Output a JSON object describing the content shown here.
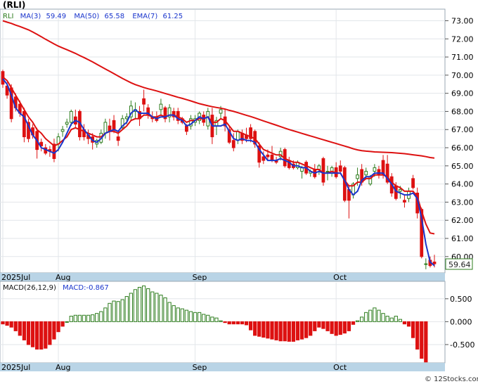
{
  "title": "(RLI)",
  "footer": "© 12Stocks.com",
  "last_price_tag": "59.64",
  "legend": {
    "ticker": "RLI",
    "ma3": "MA(3)",
    "ma3_val": "59.49",
    "ma50": "MA(50)",
    "ma50_val": "65.58",
    "ema7": "EMA(7)",
    "ema7_val": "61.25"
  },
  "macd_legend": {
    "name": "MACD(26,12,9)",
    "macd": "MACD:-0.867"
  },
  "colors": {
    "up": "#2e7d1e",
    "down": "#dd1111",
    "ma3": "#1a35cc",
    "ma50": "#dd1111",
    "ema7": "#dd1111",
    "axis_band": "#b9d4e6"
  },
  "chart_data": [
    {
      "type": "candlestick",
      "title": "(RLI)",
      "ylim": [
        59.1,
        73.6
      ],
      "yticks": [
        "73.00",
        "72.00",
        "71.00",
        "70.00",
        "69.00",
        "68.00",
        "67.00",
        "66.00",
        "65.00",
        "64.00",
        "63.00",
        "62.00",
        "61.00",
        "60.00"
      ],
      "xticks": [
        {
          "label": "2025Jul",
          "index": 0
        },
        {
          "label": "Aug",
          "index": 13
        },
        {
          "label": "Sep",
          "index": 45
        },
        {
          "label": "Oct",
          "index": 78
        }
      ],
      "ohlc": [
        [
          70.2,
          70.3,
          69.3,
          69.5
        ],
        [
          69.4,
          69.6,
          68.7,
          68.9
        ],
        [
          69.3,
          69.5,
          67.4,
          67.6
        ],
        [
          68.8,
          69.0,
          68.0,
          68.2
        ],
        [
          68.4,
          68.6,
          67.7,
          67.9
        ],
        [
          68.0,
          68.2,
          66.3,
          66.6
        ],
        [
          67.4,
          67.6,
          66.3,
          66.5
        ],
        [
          67.1,
          67.3,
          66.5,
          66.7
        ],
        [
          66.9,
          67.1,
          65.4,
          65.9
        ],
        [
          66.3,
          66.5,
          65.8,
          66.1
        ],
        [
          66.0,
          66.2,
          65.6,
          65.7
        ],
        [
          65.9,
          66.1,
          65.5,
          65.8
        ],
        [
          66.2,
          66.5,
          65.2,
          65.4
        ],
        [
          66.2,
          66.8,
          65.8,
          66.6
        ],
        [
          66.9,
          67.2,
          66.6,
          67.0
        ],
        [
          67.3,
          67.6,
          67.1,
          67.4
        ],
        [
          67.4,
          68.1,
          67.2,
          68.0
        ],
        [
          67.7,
          68.1,
          67.1,
          67.3
        ],
        [
          68.0,
          68.1,
          66.4,
          66.6
        ],
        [
          67.0,
          67.3,
          66.4,
          66.6
        ],
        [
          66.7,
          67.0,
          66.2,
          66.5
        ],
        [
          66.6,
          66.8,
          65.9,
          66.3
        ],
        [
          66.2,
          66.5,
          66.0,
          66.4
        ],
        [
          66.3,
          67.0,
          66.2,
          66.8
        ],
        [
          66.8,
          67.6,
          66.5,
          67.4
        ],
        [
          67.2,
          67.6,
          66.4,
          66.9
        ],
        [
          67.5,
          67.8,
          66.8,
          67.0
        ],
        [
          66.6,
          66.9,
          66.1,
          66.4
        ],
        [
          67.1,
          67.8,
          67.0,
          67.6
        ],
        [
          67.6,
          67.9,
          67.3,
          67.7
        ],
        [
          67.7,
          68.6,
          67.5,
          68.3
        ],
        [
          68.0,
          68.5,
          67.6,
          68.1
        ],
        [
          68.0,
          68.3,
          67.2,
          67.6
        ],
        [
          68.7,
          69.2,
          68.0,
          68.4
        ],
        [
          68.2,
          68.4,
          67.6,
          67.8
        ],
        [
          67.7,
          68.0,
          67.4,
          67.6
        ],
        [
          67.7,
          68.0,
          67.4,
          67.5
        ],
        [
          68.1,
          68.7,
          67.8,
          68.4
        ],
        [
          68.2,
          68.3,
          67.4,
          67.6
        ],
        [
          67.7,
          68.4,
          67.4,
          68.2
        ],
        [
          68.0,
          68.2,
          67.5,
          67.7
        ],
        [
          68.0,
          68.2,
          67.3,
          67.5
        ],
        [
          67.6,
          67.7,
          67.3,
          67.4
        ],
        [
          67.2,
          67.3,
          66.7,
          66.9
        ],
        [
          67.2,
          67.8,
          67.0,
          67.6
        ],
        [
          67.4,
          67.8,
          67.2,
          67.6
        ],
        [
          67.5,
          68.0,
          67.3,
          67.9
        ],
        [
          67.8,
          68.0,
          67.2,
          67.4
        ],
        [
          67.2,
          68.2,
          67.0,
          68.0
        ],
        [
          67.8,
          68.2,
          66.2,
          66.6
        ],
        [
          67.2,
          67.7,
          66.7,
          67.5
        ],
        [
          67.9,
          68.3,
          67.6,
          68.1
        ],
        [
          67.7,
          68.1,
          66.9,
          67.2
        ],
        [
          67.0,
          67.2,
          66.2,
          66.3
        ],
        [
          66.4,
          66.8,
          65.8,
          66.0
        ],
        [
          66.4,
          67.0,
          66.2,
          66.9
        ],
        [
          66.8,
          67.0,
          66.2,
          66.4
        ],
        [
          66.7,
          67.1,
          66.3,
          66.5
        ],
        [
          67.1,
          67.3,
          66.3,
          66.5
        ],
        [
          66.9,
          67.0,
          66.0,
          66.2
        ],
        [
          66.1,
          66.3,
          64.9,
          65.2
        ],
        [
          65.5,
          65.8,
          65.1,
          65.3
        ],
        [
          65.6,
          65.9,
          65.3,
          65.5
        ],
        [
          65.6,
          66.1,
          65.2,
          65.3
        ],
        [
          65.3,
          65.5,
          65.1,
          65.2
        ],
        [
          65.5,
          66.0,
          65.3,
          65.8
        ],
        [
          65.9,
          66.0,
          64.9,
          65.0
        ],
        [
          65.3,
          65.5,
          64.8,
          64.9
        ],
        [
          65.1,
          65.3,
          64.8,
          64.9
        ],
        [
          64.9,
          65.3,
          64.8,
          65.2
        ],
        [
          64.7,
          65.0,
          64.3,
          64.9
        ],
        [
          65.2,
          65.3,
          64.5,
          64.6
        ],
        [
          64.6,
          64.8,
          64.4,
          64.7
        ],
        [
          64.8,
          65.1,
          64.3,
          64.4
        ],
        [
          64.8,
          65.1,
          64.5,
          65.0
        ],
        [
          65.4,
          65.5,
          63.9,
          64.1
        ],
        [
          64.7,
          65.0,
          64.2,
          64.7
        ],
        [
          64.6,
          65.0,
          64.4,
          64.9
        ],
        [
          64.9,
          65.2,
          64.3,
          64.4
        ],
        [
          65.0,
          65.3,
          64.6,
          64.7
        ],
        [
          64.9,
          65.0,
          63.0,
          63.1
        ],
        [
          63.7,
          63.9,
          62.1,
          63.1
        ],
        [
          63.4,
          64.1,
          63.2,
          64.0
        ],
        [
          64.3,
          64.9,
          63.9,
          64.5
        ],
        [
          64.8,
          65.1,
          63.9,
          64.1
        ],
        [
          64.5,
          64.9,
          64.3,
          64.7
        ],
        [
          64.0,
          64.5,
          63.9,
          64.4
        ],
        [
          64.7,
          65.1,
          64.4,
          64.9
        ],
        [
          64.8,
          65.0,
          64.3,
          64.5
        ],
        [
          65.3,
          65.6,
          64.3,
          64.5
        ],
        [
          65.1,
          65.6,
          64.0,
          64.1
        ],
        [
          64.4,
          64.6,
          63.3,
          63.5
        ],
        [
          63.9,
          64.1,
          63.1,
          63.2
        ],
        [
          63.6,
          63.9,
          63.2,
          63.7
        ],
        [
          63.1,
          63.4,
          62.7,
          63.0
        ],
        [
          63.2,
          63.8,
          63.0,
          63.6
        ],
        [
          64.3,
          64.5,
          63.7,
          63.8
        ],
        [
          63.5,
          63.8,
          62.1,
          62.4
        ],
        [
          62.6,
          62.7,
          59.9,
          60.0
        ],
        [
          59.6,
          59.9,
          59.3,
          59.6
        ],
        [
          59.8,
          60.0,
          59.4,
          59.5
        ],
        [
          59.7,
          60.1,
          59.4,
          59.6
        ]
      ],
      "series": [
        {
          "name": "MA(3)",
          "values": [
            69.8,
            69.5,
            68.9,
            68.2,
            67.9,
            67.7,
            67.2,
            66.7,
            66.4,
            66.0,
            65.9,
            65.8,
            65.7,
            65.9,
            66.3,
            66.8,
            67.3,
            67.5,
            67.4,
            67.0,
            66.7,
            66.4,
            66.3,
            66.5,
            66.8,
            66.9,
            67.0,
            66.9,
            67.2,
            67.4,
            67.9,
            68.1,
            67.9,
            67.9,
            67.9,
            67.7,
            67.6,
            67.7,
            67.7,
            67.8,
            67.8,
            67.6,
            67.5,
            67.2,
            67.3,
            67.5,
            67.7,
            67.6,
            67.7,
            67.2,
            67.2,
            67.2,
            67.3,
            66.9,
            66.5,
            66.4,
            66.5,
            66.4,
            66.4,
            66.3,
            65.9,
            65.6,
            65.3,
            65.3,
            65.3,
            65.4,
            65.3,
            65.2,
            65.0,
            65.0,
            64.9,
            64.9,
            64.7,
            64.6,
            64.7,
            64.6,
            64.6,
            64.6,
            64.6,
            64.6,
            64.2,
            63.7,
            63.4,
            63.6,
            64.2,
            64.4,
            64.4,
            64.6,
            64.6,
            64.6,
            64.3,
            64.0,
            63.6,
            63.5,
            63.4,
            63.4,
            63.5,
            63.2,
            62.1,
            60.7,
            59.7,
            59.5
          ]
        },
        {
          "name": "MA(50)",
          "values": [
            73.0,
            72.92,
            72.85,
            72.76,
            72.68,
            72.59,
            72.5,
            72.38,
            72.25,
            72.12,
            71.98,
            71.85,
            71.72,
            71.6,
            71.5,
            71.4,
            71.3,
            71.2,
            71.08,
            70.97,
            70.85,
            70.73,
            70.6,
            70.47,
            70.34,
            70.21,
            70.08,
            69.95,
            69.82,
            69.7,
            69.58,
            69.48,
            69.4,
            69.32,
            69.25,
            69.19,
            69.13,
            69.06,
            68.99,
            68.92,
            68.85,
            68.78,
            68.72,
            68.65,
            68.58,
            68.5,
            68.43,
            68.37,
            68.31,
            68.26,
            68.22,
            68.18,
            68.13,
            68.06,
            68.0,
            67.93,
            67.86,
            67.79,
            67.72,
            67.64,
            67.56,
            67.48,
            67.4,
            67.32,
            67.24,
            67.16,
            67.08,
            67.0,
            66.93,
            66.86,
            66.79,
            66.72,
            66.65,
            66.58,
            66.51,
            66.44,
            66.37,
            66.3,
            66.23,
            66.16,
            66.09,
            66.02,
            65.94,
            65.88,
            65.84,
            65.81,
            65.79,
            65.77,
            65.76,
            65.75,
            65.74,
            65.73,
            65.71,
            65.69,
            65.67,
            65.64,
            65.61,
            65.58,
            65.55,
            65.51,
            65.46,
            65.43
          ]
        },
        {
          "name": "EMA(7)",
          "values": [
            69.9,
            69.7,
            69.3,
            68.9,
            68.5,
            68.1,
            67.7,
            67.4,
            67.0,
            66.8,
            66.5,
            66.3,
            66.1,
            66.2,
            66.4,
            66.6,
            67.0,
            67.1,
            67.0,
            66.9,
            66.8,
            66.7,
            66.6,
            66.6,
            66.8,
            66.9,
            66.9,
            66.8,
            67.0,
            67.2,
            67.5,
            67.6,
            67.6,
            67.8,
            67.8,
            67.7,
            67.7,
            67.8,
            67.7,
            67.8,
            67.8,
            67.7,
            67.6,
            67.4,
            67.5,
            67.5,
            67.6,
            67.6,
            67.7,
            67.4,
            67.4,
            67.6,
            67.5,
            67.2,
            66.9,
            66.9,
            66.8,
            66.7,
            66.6,
            66.5,
            66.2,
            65.9,
            65.8,
            65.7,
            65.6,
            65.6,
            65.4,
            65.3,
            65.2,
            65.2,
            65.1,
            65.0,
            64.9,
            64.8,
            64.8,
            64.6,
            64.6,
            64.7,
            64.6,
            64.6,
            64.2,
            63.9,
            63.9,
            64.1,
            64.1,
            64.3,
            64.3,
            64.5,
            64.5,
            64.5,
            64.4,
            64.1,
            63.9,
            63.8,
            63.6,
            63.6,
            63.6,
            63.3,
            62.5,
            61.8,
            61.3,
            61.25
          ]
        }
      ]
    },
    {
      "type": "bar",
      "title": "MACD(26,12,9)",
      "ylim": [
        -0.9,
        0.85
      ],
      "yticks": [
        "0.500",
        "0.000",
        "-0.500"
      ],
      "xticks": [
        {
          "label": "2025Jul",
          "index": 0
        },
        {
          "label": "Aug",
          "index": 13
        },
        {
          "label": "Sep",
          "index": 45
        },
        {
          "label": "Oct",
          "index": 78
        }
      ],
      "values": [
        -0.05,
        -0.08,
        -0.12,
        -0.2,
        -0.3,
        -0.4,
        -0.5,
        -0.55,
        -0.6,
        -0.6,
        -0.58,
        -0.5,
        -0.38,
        -0.22,
        -0.1,
        0.0,
        0.12,
        0.14,
        0.14,
        0.14,
        0.14,
        0.15,
        0.18,
        0.22,
        0.3,
        0.4,
        0.45,
        0.44,
        0.48,
        0.55,
        0.62,
        0.7,
        0.75,
        0.78,
        0.72,
        0.65,
        0.62,
        0.58,
        0.52,
        0.42,
        0.35,
        0.3,
        0.28,
        0.25,
        0.22,
        0.2,
        0.2,
        0.16,
        0.14,
        0.1,
        0.08,
        0.02,
        -0.02,
        -0.05,
        -0.05,
        -0.05,
        -0.05,
        -0.07,
        -0.18,
        -0.3,
        -0.32,
        -0.34,
        -0.36,
        -0.38,
        -0.4,
        -0.42,
        -0.42,
        -0.43,
        -0.43,
        -0.4,
        -0.38,
        -0.35,
        -0.3,
        -0.2,
        -0.12,
        -0.15,
        -0.2,
        -0.26,
        -0.3,
        -0.28,
        -0.25,
        -0.2,
        -0.06,
        0.02,
        0.1,
        0.2,
        0.25,
        0.3,
        0.25,
        0.18,
        0.12,
        0.08,
        0.12,
        0.05,
        -0.05,
        -0.1,
        -0.35,
        -0.6,
        -0.8,
        -0.88
      ]
    }
  ]
}
